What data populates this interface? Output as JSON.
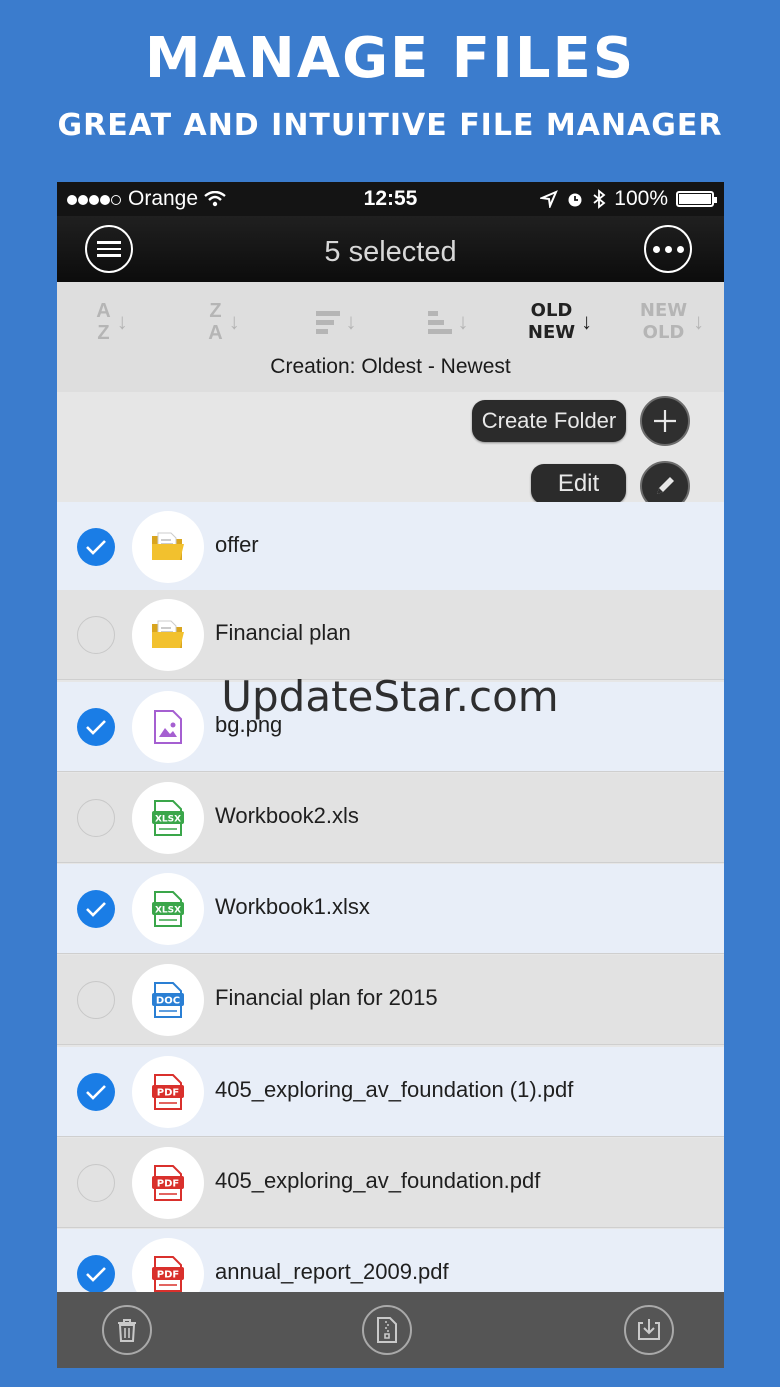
{
  "promo": {
    "title": "MANAGE FILES",
    "subtitle": "GREAT AND INTUITIVE FILE MANAGER"
  },
  "status_bar": {
    "carrier": "Orange",
    "time": "12:55",
    "battery": "100%"
  },
  "nav": {
    "title": "5 selected",
    "menu_icon": "hamburger-icon",
    "more_icon": "more-icon"
  },
  "sort": {
    "options": [
      {
        "top": "A",
        "bottom": "Z"
      },
      {
        "top": "Z",
        "bottom": "A"
      },
      {
        "icon": "size-descending-icon"
      },
      {
        "icon": "size-ascending-icon"
      },
      {
        "top": "OLD",
        "bottom": "NEW",
        "active": true
      },
      {
        "top": "NEW",
        "bottom": "OLD"
      }
    ],
    "caption": "Creation: Oldest - Newest"
  },
  "actions": {
    "create_folder": "Create Folder",
    "edit": "Edit"
  },
  "files": [
    {
      "name": "offer",
      "type": "folder",
      "selected": true
    },
    {
      "name": "Financial plan",
      "type": "folder",
      "selected": false
    },
    {
      "name": "bg.png",
      "type": "image",
      "selected": true
    },
    {
      "name": "Workbook2.xls",
      "type": "XLSX",
      "selected": false
    },
    {
      "name": "Workbook1.xlsx",
      "type": "XLSX",
      "selected": true
    },
    {
      "name": "Financial plan for 2015",
      "type": "DOC",
      "selected": false
    },
    {
      "name": "405_exploring_av_foundation (1).pdf",
      "type": "PDF",
      "selected": true
    },
    {
      "name": "405_exploring_av_foundation.pdf",
      "type": "PDF",
      "selected": false
    },
    {
      "name": "annual_report_2009.pdf",
      "type": "PDF",
      "selected": true
    }
  ],
  "watermark": "UpdateStar.com",
  "toolbar": {
    "buttons": [
      "trash-icon",
      "zip-icon",
      "download-icon"
    ]
  },
  "colors": {
    "background": "#3b7ccd",
    "check_blue": "#1a7de6",
    "folder": "#f2c12e",
    "image": "#a55fd1",
    "xlsx": "#3aa64a",
    "doc": "#2a7fd4",
    "pdf": "#d9302c"
  }
}
